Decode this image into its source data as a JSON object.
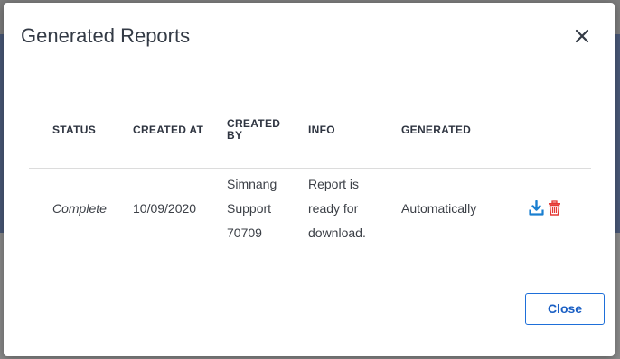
{
  "dialog": {
    "title": "Generated Reports",
    "close_button_label": "Close"
  },
  "table": {
    "headers": {
      "status": "STATUS",
      "created_at": "CREATED AT",
      "created_by_line1": "CREATED",
      "created_by_line2": "BY",
      "info": "INFO",
      "generated": "GENERATED"
    },
    "rows": [
      {
        "status": "Complete",
        "created_at": "10/09/2020",
        "created_by": [
          "Simnang",
          "Support",
          "70709"
        ],
        "info": [
          "Report is",
          "ready for",
          "download."
        ],
        "generated": "Automatically",
        "actions": [
          "download-icon",
          "trash-icon"
        ]
      }
    ]
  },
  "colors": {
    "download_icon": "#1a7fd0",
    "delete_icon": "#e53935",
    "button_border": "#1e6fd9",
    "button_text": "#1a5fc4"
  }
}
